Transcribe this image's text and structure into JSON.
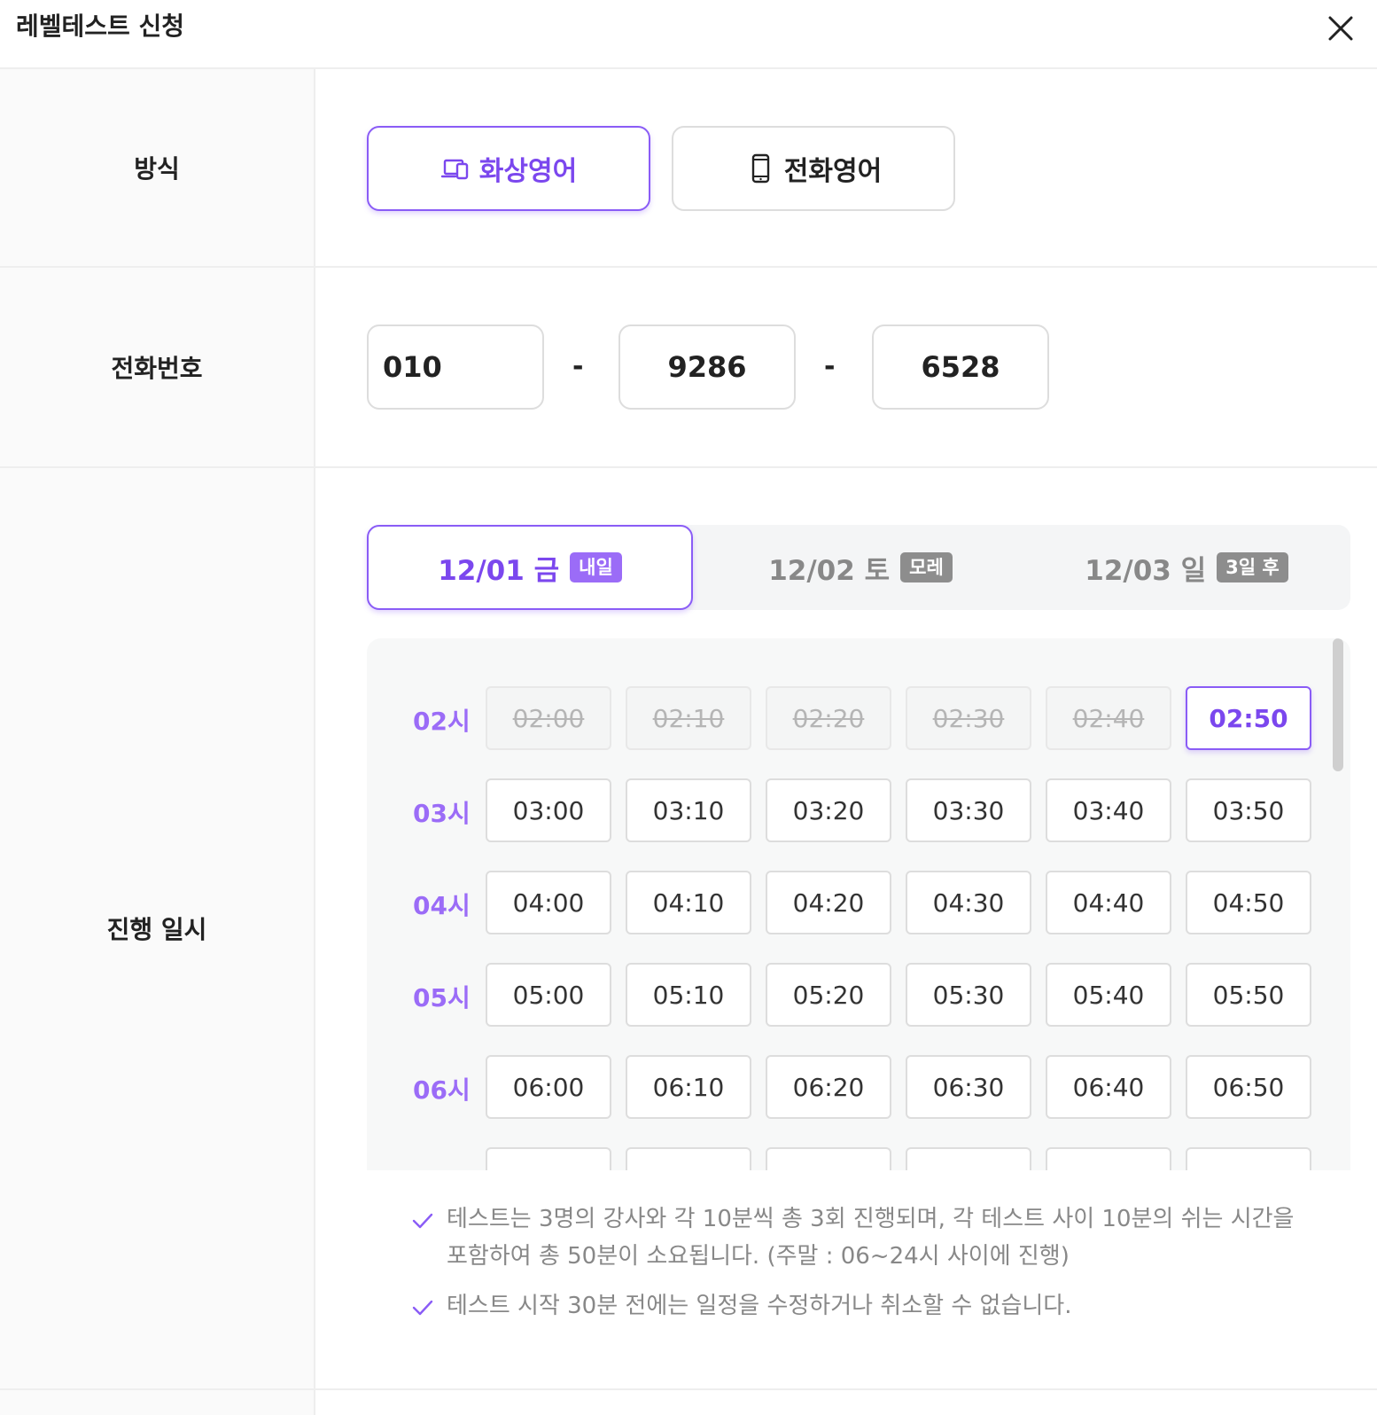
{
  "header": {
    "title": "레벨테스트 신청",
    "close_icon": "close-icon"
  },
  "method": {
    "label": "방식",
    "options": [
      {
        "label": "화상영어",
        "icon": "video-devices-icon",
        "selected": true
      },
      {
        "label": "전화영어",
        "icon": "smartphone-icon",
        "selected": false
      }
    ]
  },
  "phone": {
    "label": "전화번호",
    "part1": "010",
    "separator": "-",
    "part2": "9286",
    "part3": "6528"
  },
  "schedule": {
    "label": "진행 일시",
    "dates": [
      {
        "date": "12/01 금",
        "badge": "내일",
        "selected": true
      },
      {
        "date": "12/02 토",
        "badge": "모레",
        "selected": false
      },
      {
        "date": "12/03 일",
        "badge": "3일 후",
        "selected": false
      }
    ],
    "hours": [
      {
        "label": "02시",
        "slots": [
          {
            "time": "02:00",
            "state": "disabled"
          },
          {
            "time": "02:10",
            "state": "disabled"
          },
          {
            "time": "02:20",
            "state": "disabled"
          },
          {
            "time": "02:30",
            "state": "disabled"
          },
          {
            "time": "02:40",
            "state": "disabled"
          },
          {
            "time": "02:50",
            "state": "selected"
          }
        ]
      },
      {
        "label": "03시",
        "slots": [
          {
            "time": "03:00",
            "state": "available"
          },
          {
            "time": "03:10",
            "state": "available"
          },
          {
            "time": "03:20",
            "state": "available"
          },
          {
            "time": "03:30",
            "state": "available"
          },
          {
            "time": "03:40",
            "state": "available"
          },
          {
            "time": "03:50",
            "state": "available"
          }
        ]
      },
      {
        "label": "04시",
        "slots": [
          {
            "time": "04:00",
            "state": "available"
          },
          {
            "time": "04:10",
            "state": "available"
          },
          {
            "time": "04:20",
            "state": "available"
          },
          {
            "time": "04:30",
            "state": "available"
          },
          {
            "time": "04:40",
            "state": "available"
          },
          {
            "time": "04:50",
            "state": "available"
          }
        ]
      },
      {
        "label": "05시",
        "slots": [
          {
            "time": "05:00",
            "state": "available"
          },
          {
            "time": "05:10",
            "state": "available"
          },
          {
            "time": "05:20",
            "state": "available"
          },
          {
            "time": "05:30",
            "state": "available"
          },
          {
            "time": "05:40",
            "state": "available"
          },
          {
            "time": "05:50",
            "state": "available"
          }
        ]
      },
      {
        "label": "06시",
        "slots": [
          {
            "time": "06:00",
            "state": "available"
          },
          {
            "time": "06:10",
            "state": "available"
          },
          {
            "time": "06:20",
            "state": "available"
          },
          {
            "time": "06:30",
            "state": "available"
          },
          {
            "time": "06:40",
            "state": "available"
          },
          {
            "time": "06:50",
            "state": "available"
          }
        ]
      },
      {
        "label": "",
        "slots": [
          {
            "time": "",
            "state": "available"
          },
          {
            "time": "",
            "state": "available"
          },
          {
            "time": "",
            "state": "available"
          },
          {
            "time": "",
            "state": "available"
          },
          {
            "time": "",
            "state": "available"
          },
          {
            "time": "",
            "state": "available"
          }
        ]
      }
    ],
    "notes": [
      "테스트는 3명의 강사와 각 10분씩 총 3회 진행되며, 각 테스트 사이 10분의 쉬는 시간을 포함하여 총 50분이 소요됩니다. (주말 : 06~24시 사이에 진행)",
      "테스트 시작 30분 전에는 일정을 수정하거나 취소할 수 없습니다."
    ]
  },
  "colors": {
    "accent": "#8a5cf6",
    "accent_text": "#7b47ee",
    "border": "#dddddd",
    "muted": "#888888"
  }
}
